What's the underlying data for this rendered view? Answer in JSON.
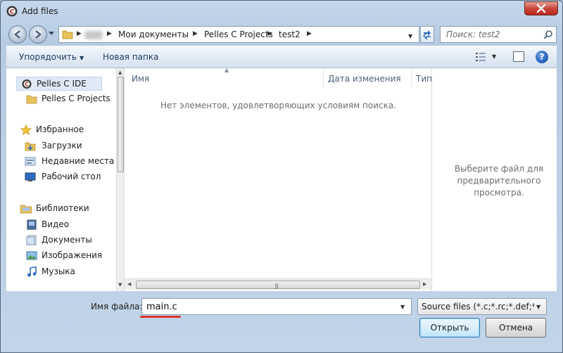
{
  "window": {
    "title": "Add files"
  },
  "address": {
    "crumbs": [
      "Мои документы",
      "Pelles C Projects",
      "test2"
    ]
  },
  "search": {
    "placeholder": "Поиск: test2"
  },
  "toolbar": {
    "organize": "Упорядочить",
    "new_folder": "Новая папка"
  },
  "nav": {
    "items": [
      {
        "label": "Pelles C IDE",
        "icon": "pelles-c-app-icon"
      },
      {
        "label": "Pelles C Projects",
        "icon": "folder-icon"
      },
      {
        "label": "Избранное",
        "icon": "star-icon"
      },
      {
        "label": "Загрузки",
        "icon": "downloads-folder-icon"
      },
      {
        "label": "Недавние места",
        "icon": "recent-places-icon"
      },
      {
        "label": "Рабочий стол",
        "icon": "desktop-icon"
      },
      {
        "label": "Библиотеки",
        "icon": "libraries-icon"
      },
      {
        "label": "Видео",
        "icon": "video-icon"
      },
      {
        "label": "Документы",
        "icon": "documents-icon"
      },
      {
        "label": "Изображения",
        "icon": "pictures-icon"
      },
      {
        "label": "Музыка",
        "icon": "music-icon"
      }
    ]
  },
  "files": {
    "columns": [
      "Имя",
      "Дата изменения",
      "Тип"
    ],
    "empty_message": "Нет элементов, удовлетворяющих условиям поиска."
  },
  "preview": {
    "message": "Выберите файл для предварительного просмотра."
  },
  "bottom": {
    "filename_label": "Имя файла:",
    "filename_value": "main.c",
    "filter_value": "Source files (*.c;*.rc;*.def;*.asm)",
    "open_button": "Открыть",
    "cancel_button": "Отмена"
  },
  "colors": {
    "annotation_underline": "#d5382a",
    "accent": "#1f5bb8"
  }
}
